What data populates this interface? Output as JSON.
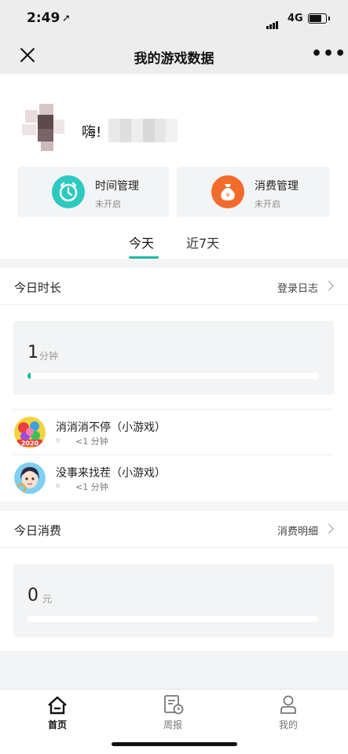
{
  "status_bar": {
    "time": "2:49",
    "network": "4G"
  },
  "nav": {
    "title": "我的游戏数据"
  },
  "profile": {
    "greeting": "嗨!"
  },
  "management": [
    {
      "label": "时间管理",
      "status": "未开启",
      "icon": "alarm-clock-icon",
      "color": "#2ec9c0"
    },
    {
      "label": "消费管理",
      "status": "未开启",
      "icon": "money-bag-icon",
      "color": "#f36b2a"
    }
  ],
  "tabs": [
    {
      "label": "今天",
      "active": true
    },
    {
      "label": "近7天",
      "active": false
    }
  ],
  "duration_section": {
    "title": "今日时长",
    "link": "登录日志",
    "value": "1",
    "unit": "分钟",
    "progress": 0.01,
    "games": [
      {
        "name": "消消消不停（小游戏）",
        "duration": "<1 分钟",
        "icon": "game-candy-icon"
      },
      {
        "name": "没事来找茬（小游戏）",
        "duration": "<1 分钟",
        "icon": "game-girl-icon"
      }
    ]
  },
  "spend_section": {
    "title": "今日消费",
    "link": "消费明细",
    "value": "0",
    "unit": "元",
    "progress": 0
  },
  "tabbar": [
    {
      "label": "首页",
      "icon": "home-icon",
      "active": true
    },
    {
      "label": "周报",
      "icon": "report-icon",
      "active": false
    },
    {
      "label": "我的",
      "icon": "person-icon",
      "active": false
    }
  ],
  "colors": {
    "accent": "#1fb8a5",
    "page_bg": "#f3f4f5"
  }
}
